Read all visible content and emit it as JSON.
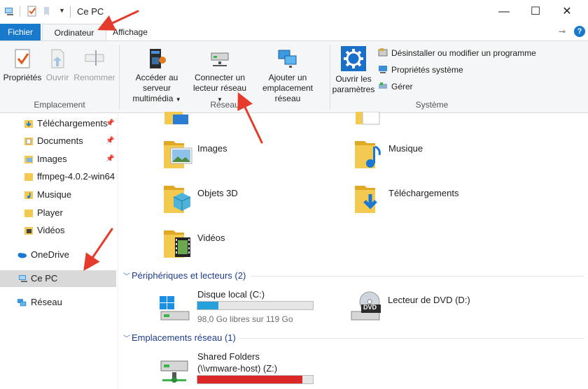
{
  "window": {
    "title": "Ce PC",
    "controls": {
      "minimize": "—",
      "maximize": "☐",
      "close": "✕"
    }
  },
  "tabs": {
    "file": "Fichier",
    "computer": "Ordinateur",
    "view": "Affichage"
  },
  "help_glyph": "?",
  "ribbon": {
    "groups": {
      "location": {
        "label": "Emplacement",
        "buttons": [
          "Propriétés",
          "Ouvrir",
          "Renommer"
        ]
      },
      "network": {
        "label": "Réseau",
        "media_server": [
          "Accéder au serveur",
          "multimédia"
        ],
        "map_drive": [
          "Connecter un",
          "lecteur réseau"
        ],
        "add_location": [
          "Ajouter un",
          "emplacement réseau"
        ]
      },
      "system": {
        "label": "Système",
        "open_settings": [
          "Ouvrir les",
          "paramètres"
        ],
        "commands": [
          "Désinstaller ou modifier un programme",
          "Propriétés système",
          "Gérer"
        ]
      }
    }
  },
  "nav": {
    "quick": [
      "Téléchargements",
      "Documents",
      "Images",
      "ffmpeg-4.0.2-win64",
      "Musique",
      "Player",
      "Vidéos"
    ],
    "onedrive": "OneDrive",
    "thispc": "Ce PC",
    "network": "Réseau"
  },
  "folders": {
    "images": "Images",
    "music": "Musique",
    "objects3d": "Objets 3D",
    "downloads": "Téléchargements",
    "videos": "Vidéos"
  },
  "devices": {
    "header": "Périphériques et lecteurs (2)",
    "local_disk": {
      "name": "Disque local (C:)",
      "free": "98,0 Go libres sur 119 Go",
      "used_fraction": 0.18,
      "bar_color": "#26a0da"
    },
    "dvd": {
      "name": "Lecteur de DVD (D:)",
      "badge": "DVD"
    }
  },
  "network_locations": {
    "header": "Emplacements réseau (1)",
    "shared": {
      "name": "Shared Folders",
      "path": "(\\\\vmware-host) (Z:)",
      "used_fraction": 0.91,
      "bar_color": "#da2626"
    }
  },
  "colors": {
    "accent": "#1979ca",
    "arrow": "#e53b2c",
    "folder": "#f3c94f",
    "folder_dark": "#e0a923"
  }
}
